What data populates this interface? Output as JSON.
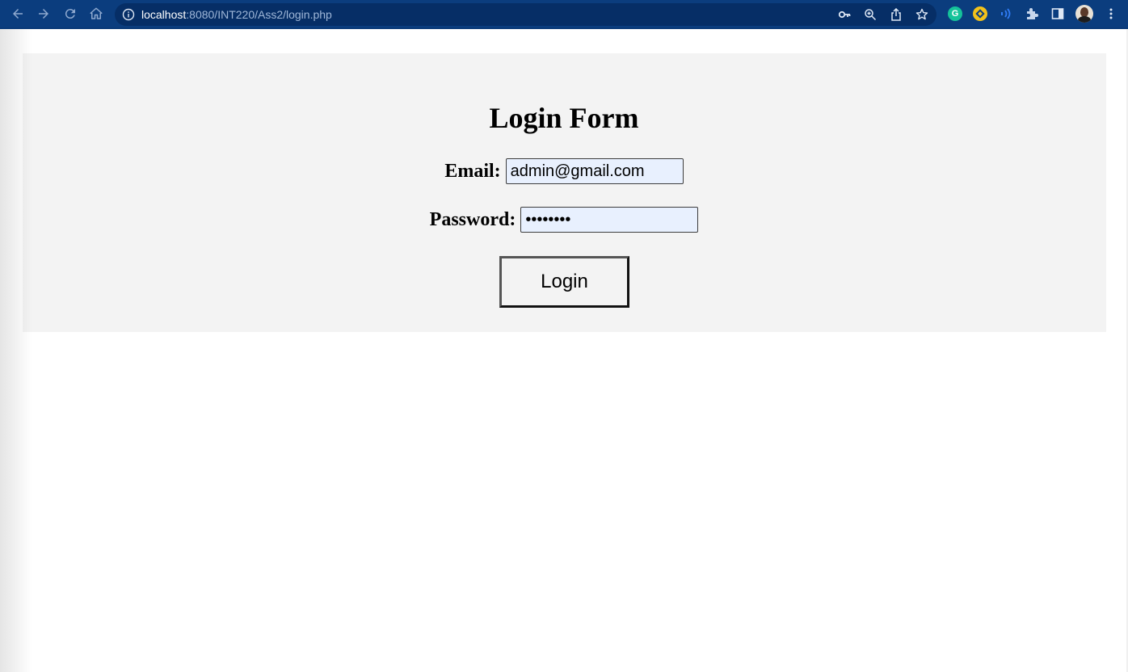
{
  "browser": {
    "url_host": "localhost",
    "url_rest": ":8080/INT220/Ass2/login.php",
    "nav_icons": [
      "back-arrow-icon",
      "forward-arrow-icon",
      "reload-icon",
      "home-icon"
    ],
    "omnibox_icons": [
      "key-icon",
      "zoom-icon",
      "share-icon",
      "bookmark-star-icon"
    ],
    "extension_icons": [
      "grammarly-icon",
      "yellow-extension-icon",
      "audio-extension-icon",
      "puzzle-extensions-icon",
      "side-panel-icon"
    ],
    "grammarly_letter": "G",
    "colors": {
      "toolbar": "#0b3d7e",
      "omnibox": "#062e66"
    }
  },
  "page": {
    "title": "Login Form",
    "email": {
      "label": "Email:",
      "value": "admin@gmail.com"
    },
    "password": {
      "label": "Password:",
      "value": "12345678"
    },
    "login_button": "Login",
    "colors": {
      "panel": "#f3f3f3",
      "autofill": "#e8f0fe"
    }
  }
}
